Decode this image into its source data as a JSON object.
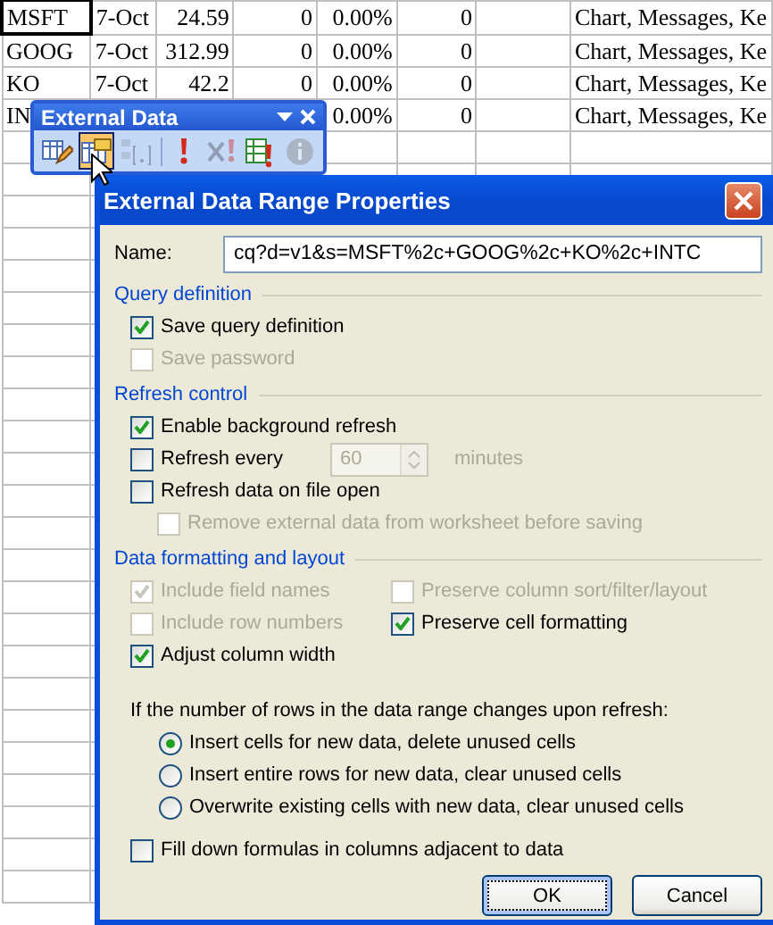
{
  "sheet": {
    "rows": [
      {
        "selected": true,
        "column_1": "MSFT",
        "column_2": "7-Oct",
        "column_3": "24.59",
        "column_4": "0",
        "column_5": "0.00%",
        "column_6": "0",
        "column_8": "Chart, Messages, Ke"
      },
      {
        "selected": false,
        "column_1": "GOOG",
        "column_2": "7-Oct",
        "column_3": "312.99",
        "column_4": "0",
        "column_5": "0.00%",
        "column_6": "0",
        "column_8": "Chart, Messages, Ke"
      },
      {
        "selected": false,
        "column_1": "KO",
        "column_2": "7-Oct",
        "column_3": "42.2",
        "column_4": "0",
        "column_5": "0.00%",
        "column_6": "0",
        "column_8": "Chart, Messages, Ke"
      },
      {
        "selected": false,
        "column_1": "IN",
        "column_5": "0.00%",
        "column_6": "0",
        "column_8": "Chart, Messages, Ke"
      }
    ]
  },
  "toolbar": {
    "title": "External Data",
    "buttons": [
      {
        "kind": "edit-query",
        "selected": false,
        "disabled": false
      },
      {
        "kind": "range-properties",
        "selected": true,
        "disabled": false
      },
      {
        "kind": "parameters",
        "selected": false,
        "disabled": true
      },
      {
        "kind": "separator"
      },
      {
        "kind": "refresh",
        "selected": false,
        "disabled": false
      },
      {
        "kind": "cancel-refresh",
        "selected": false,
        "disabled": true
      },
      {
        "kind": "refresh-all",
        "selected": false,
        "disabled": false
      },
      {
        "kind": "status",
        "selected": false,
        "disabled": true
      }
    ]
  },
  "dialog": {
    "title": "External Data Range Properties",
    "name_label": "Name:",
    "name_value": "cq?d=v1&s=MSFT%2c+GOOG%2c+KO%2c+INTC",
    "sections": [
      {
        "heading": "Query definition",
        "kind": "single",
        "items": [
          {
            "kind": "checkbox",
            "label": "Save query definition",
            "checked": true,
            "disabled": false,
            "indented": false
          },
          {
            "kind": "checkbox",
            "label": "Save password",
            "checked": false,
            "disabled": true,
            "indented": false
          }
        ]
      },
      {
        "heading": "Refresh control",
        "kind": "single",
        "items": [
          {
            "kind": "checkbox",
            "label": "Enable background refresh",
            "checked": true,
            "disabled": false,
            "indented": false
          },
          {
            "kind": "checkbox-spinner",
            "label": "Refresh every",
            "checked": false,
            "disabled": false,
            "indented": false,
            "spinner_value": "60",
            "spinner_disabled": true,
            "unit": "minutes"
          },
          {
            "kind": "checkbox",
            "label": "Refresh data on file open",
            "checked": false,
            "disabled": false,
            "indented": false
          },
          {
            "kind": "checkbox",
            "label": "Remove external data from worksheet before saving",
            "checked": false,
            "disabled": true,
            "indented": true
          }
        ]
      },
      {
        "heading": "Data formatting and layout",
        "kind": "two-column",
        "items": [
          {
            "kind": "checkbox",
            "label": "Include field names",
            "checked": true,
            "disabled": true,
            "indented": false
          },
          {
            "kind": "checkbox",
            "label": "Preserve column sort/filter/layout",
            "checked": false,
            "disabled": true,
            "indented": false
          },
          {
            "kind": "checkbox",
            "label": "Include row numbers",
            "checked": false,
            "disabled": true,
            "indented": false
          },
          {
            "kind": "checkbox",
            "label": "Preserve cell formatting",
            "checked": true,
            "disabled": false,
            "indented": false
          },
          {
            "kind": "checkbox",
            "label": "Adjust column width",
            "checked": true,
            "disabled": false,
            "indented": false
          }
        ]
      }
    ],
    "refresh_question": "If the number of rows in the data range changes upon refresh:",
    "options": [
      {
        "label": "Insert cells for new data, delete unused cells",
        "selected": true
      },
      {
        "label": "Insert entire rows for new data, clear unused cells",
        "selected": false
      },
      {
        "label": "Overwrite existing cells with new data, clear unused cells",
        "selected": false
      }
    ],
    "fill_down": {
      "label": "Fill down formulas in columns adjacent to data",
      "checked": false
    },
    "buttons": [
      {
        "label": "OK",
        "focused": true
      },
      {
        "label": "Cancel",
        "focused": false
      }
    ]
  }
}
